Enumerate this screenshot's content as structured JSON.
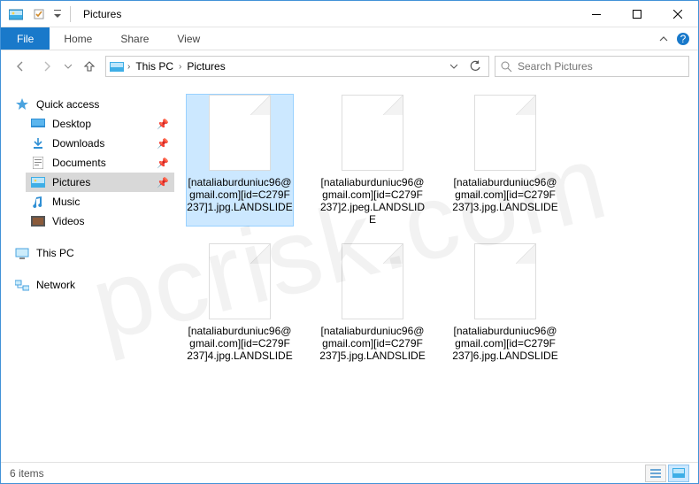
{
  "window": {
    "title": "Pictures"
  },
  "ribbon": {
    "file": "File",
    "tabs": [
      "Home",
      "Share",
      "View"
    ]
  },
  "path": {
    "root": "This PC",
    "current": "Pictures"
  },
  "search": {
    "placeholder": "Search Pictures"
  },
  "sidebar": {
    "quick": "Quick access",
    "items": [
      {
        "label": "Desktop"
      },
      {
        "label": "Downloads"
      },
      {
        "label": "Documents"
      },
      {
        "label": "Pictures"
      },
      {
        "label": "Music"
      },
      {
        "label": "Videos"
      }
    ],
    "thispc": "This PC",
    "network": "Network"
  },
  "files": [
    {
      "name": "[nataliaburduniuc96@gmail.com][id=C279F237]1.jpg.LANDSLIDE"
    },
    {
      "name": "[nataliaburduniuc96@gmail.com][id=C279F237]2.jpeg.LANDSLIDE"
    },
    {
      "name": "[nataliaburduniuc96@gmail.com][id=C279F237]3.jpg.LANDSLIDE"
    },
    {
      "name": "[nataliaburduniuc96@gmail.com][id=C279F237]4.jpg.LANDSLIDE"
    },
    {
      "name": "[nataliaburduniuc96@gmail.com][id=C279F237]5.jpg.LANDSLIDE"
    },
    {
      "name": "[nataliaburduniuc96@gmail.com][id=C279F237]6.jpg.LANDSLIDE"
    }
  ],
  "status": {
    "count": "6 items"
  },
  "watermark": "pcrisk.com"
}
